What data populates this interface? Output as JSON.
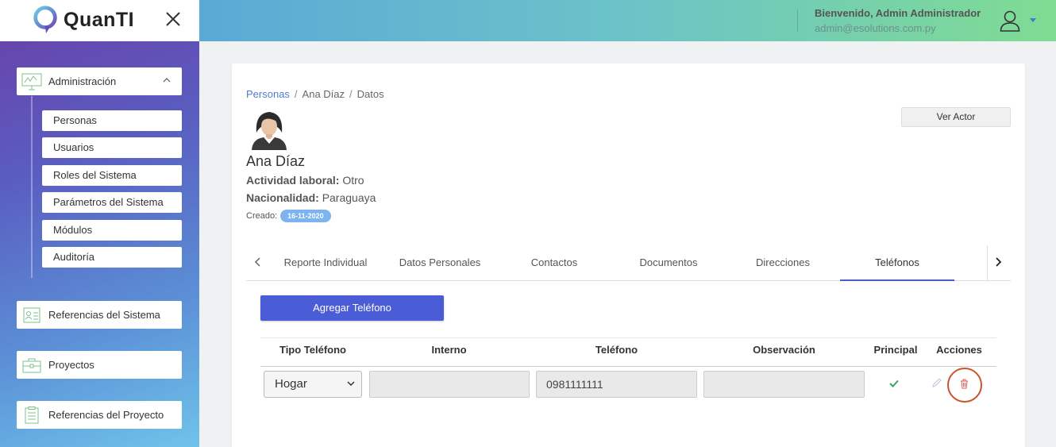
{
  "app": {
    "logo_text": "QuanTI"
  },
  "sidebar": {
    "admin_label": "Administración",
    "sub_items": [
      "Personas",
      "Usuarios",
      "Roles del Sistema",
      "Parámetros del Sistema",
      "Módulos",
      "Auditoría"
    ],
    "ref_sistema_label": "Referencias del Sistema",
    "proyectos_label": "Proyectos",
    "ref_proyecto_label": "Referencias del Proyecto"
  },
  "header": {
    "welcome": "Bienvenido, Admin Administrador",
    "email": "admin@esolutions.com.py"
  },
  "breadcrumb": {
    "link": "Personas",
    "person": "Ana Díaz",
    "current": "Datos"
  },
  "ver_actor_label": "Ver Actor",
  "person": {
    "name": "Ana Díaz",
    "actividad_label": "Actividad laboral:",
    "actividad_value": "Otro",
    "nacionalidad_label": "Nacionalidad:",
    "nacionalidad_value": "Paraguaya",
    "creado_label": "Creado:",
    "creado_value": "16-11-2020"
  },
  "tabs": [
    "Reporte Individual",
    "Datos Personales",
    "Contactos",
    "Documentos",
    "Direcciones",
    "Teléfonos"
  ],
  "active_tab": "Teléfonos",
  "add_button_label": "Agregar Teléfono",
  "table": {
    "headers": [
      "Tipo Teléfono",
      "Interno",
      "Teléfono",
      "Observación",
      "Principal",
      "Acciones"
    ],
    "row": {
      "tipo": "Hogar",
      "interno": "",
      "telefono": "0981111111",
      "observacion": ""
    }
  },
  "colors": {
    "accent": "#4a5dd6",
    "badge": "#7cb4ef",
    "check": "#3aa35b",
    "delete": "#e05a5a"
  }
}
